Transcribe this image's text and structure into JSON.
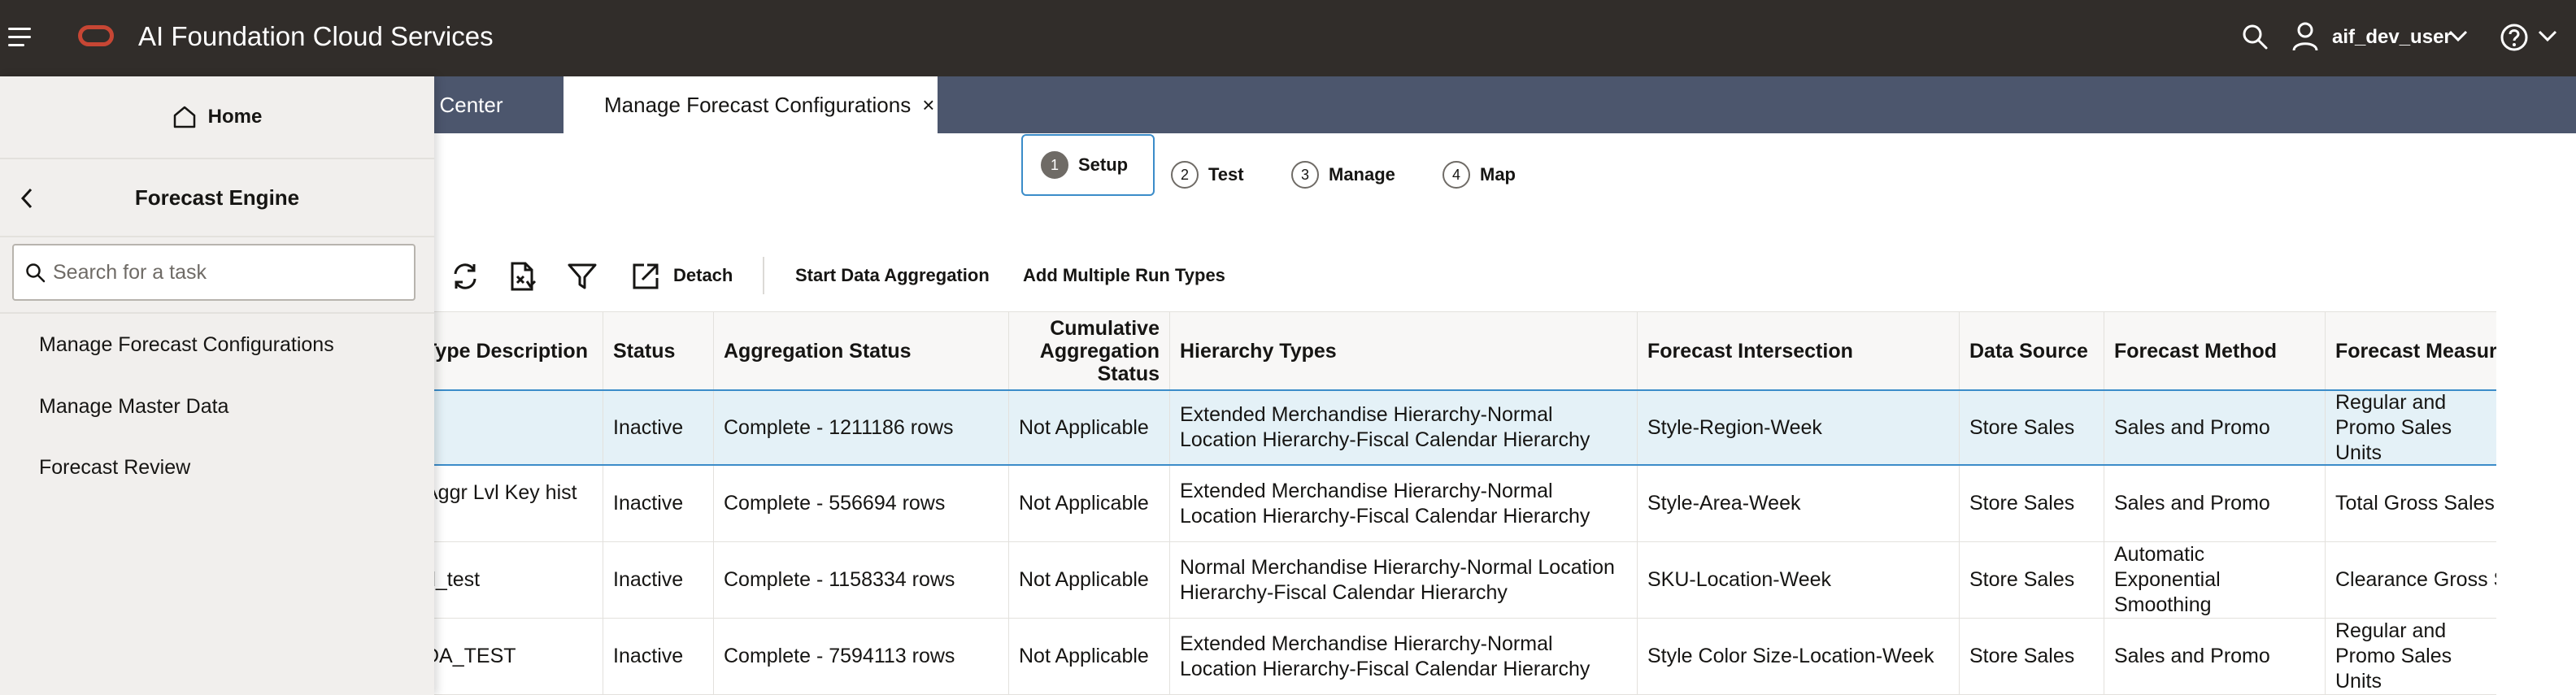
{
  "header": {
    "app_title": "AI Foundation Cloud Services",
    "user_name": "aif_dev_user",
    "icons": [
      "hamburger-menu-icon",
      "oracle-logo",
      "search-icon",
      "user-icon",
      "chevron-down-icon",
      "help-icon"
    ]
  },
  "tabs": [
    {
      "label": "cal Center",
      "active": false
    },
    {
      "label": "Manage Forecast Configurations",
      "active": true,
      "close": "×"
    }
  ],
  "steps": [
    {
      "num": "1",
      "label": "Setup",
      "active": true
    },
    {
      "num": "2",
      "label": "Test",
      "active": false
    },
    {
      "num": "3",
      "label": "Manage",
      "active": false
    },
    {
      "num": "4",
      "label": "Map",
      "active": false
    }
  ],
  "toolbar": {
    "detach": "Detach",
    "start_aggregation": "Start Data Aggregation",
    "add_run_types": "Add Multiple Run Types",
    "icons": [
      "refresh-icon",
      "export-icon",
      "filter-icon",
      "detach-icon"
    ]
  },
  "table": {
    "columns": [
      "Type Description",
      "Status",
      "Aggregation Status",
      "Cumulative Aggregation Status",
      "Hierarchy Types",
      "Forecast Intersection",
      "Data Source",
      "Forecast Method",
      "Forecast Measure"
    ],
    "rows": [
      [
        "",
        "Inactive",
        "Complete - 1211186 rows",
        "Not Applicable",
        "Extended Merchandise Hierarchy-Normal Location Hierarchy-Fiscal Calendar Hierarchy",
        "Style-Region-Week",
        "Store Sales",
        "Sales and Promo",
        "Regular and Promo Sales Units"
      ],
      [
        "Aggr Lvl Key hist",
        "Inactive",
        "Complete - 556694 rows",
        "Not Applicable",
        "Extended Merchandise Hierarchy-Normal Location Hierarchy-Fiscal Calendar Hierarchy",
        "Style-Area-Week",
        "Store Sales",
        "Sales and Promo",
        "Total Gross Sales U"
      ],
      [
        "d_test",
        "Inactive",
        "Complete - 1158334 rows",
        "Not Applicable",
        "Normal Merchandise Hierarchy-Normal Location Hierarchy-Fiscal Calendar Hierarchy",
        "SKU-Location-Week",
        "Store Sales",
        "Automatic Exponential Smoothing",
        "Clearance Gross S"
      ],
      [
        "DA_TEST",
        "Inactive",
        "Complete - 7594113 rows",
        "Not Applicable",
        "Extended Merchandise Hierarchy-Normal Location Hierarchy-Fiscal Calendar Hierarchy",
        "Style Color Size-Location-Week",
        "Store Sales",
        "Sales and Promo",
        "Regular and Promo Sales Units"
      ]
    ]
  },
  "drawer": {
    "home": "Home",
    "section_title": "Forecast Engine",
    "search_placeholder": "Search for a task",
    "tasks": [
      "Manage Forecast Configurations",
      "Manage Master Data",
      "Forecast Review"
    ]
  },
  "colors": {
    "header_bg": "#312d2a",
    "tabbar_bg": "#4c566d",
    "oracle_red": "#c74634",
    "selected_row": "#e4f1f7",
    "focus_blue": "#3b8cc9",
    "drawer_bg": "#f1efed"
  }
}
